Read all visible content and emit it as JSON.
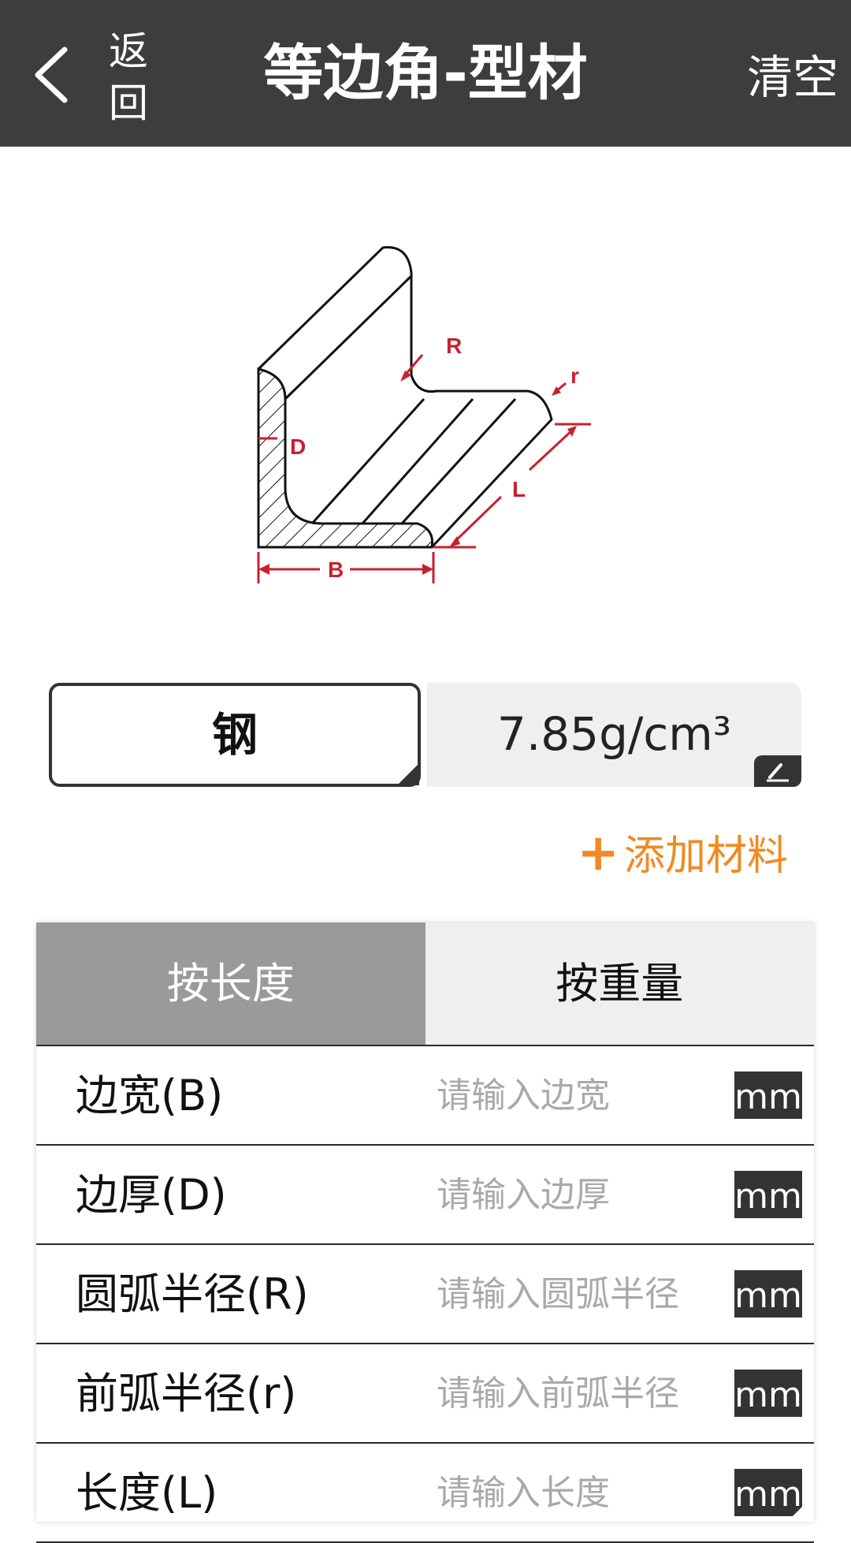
{
  "header": {
    "back_label_line1": "返",
    "back_label_line2": "回",
    "title": "等边角-型材",
    "clear_label": "清空"
  },
  "diagram": {
    "label_R": "R",
    "label_r": "r",
    "label_D": "D",
    "label_L": "L",
    "label_B": "B",
    "dimension_color": "#c8202e"
  },
  "material": {
    "name": "钢",
    "density": "7.85g/cm³"
  },
  "add_material_label": "添加材料",
  "tabs": [
    {
      "label": "按长度",
      "active": true
    },
    {
      "label": "按重量",
      "active": false
    }
  ],
  "fields": [
    {
      "label": "边宽(B)",
      "placeholder": "请输入边宽",
      "value": "",
      "unit": "mm"
    },
    {
      "label": "边厚(D)",
      "placeholder": "请输入边厚",
      "value": "",
      "unit": "mm"
    },
    {
      "label": "圆弧半径(R)",
      "placeholder": "请输入圆弧半径",
      "value": "",
      "unit": "mm"
    },
    {
      "label": "前弧半径(r)",
      "placeholder": "请输入前弧半径",
      "value": "",
      "unit": "mm"
    },
    {
      "label": "长度(L)",
      "placeholder": "请输入长度",
      "value": "",
      "unit": "mm"
    }
  ],
  "colors": {
    "header_bg": "#3d3d3d",
    "accent": "#f08a24",
    "active_tab": "#9a9a9a"
  }
}
